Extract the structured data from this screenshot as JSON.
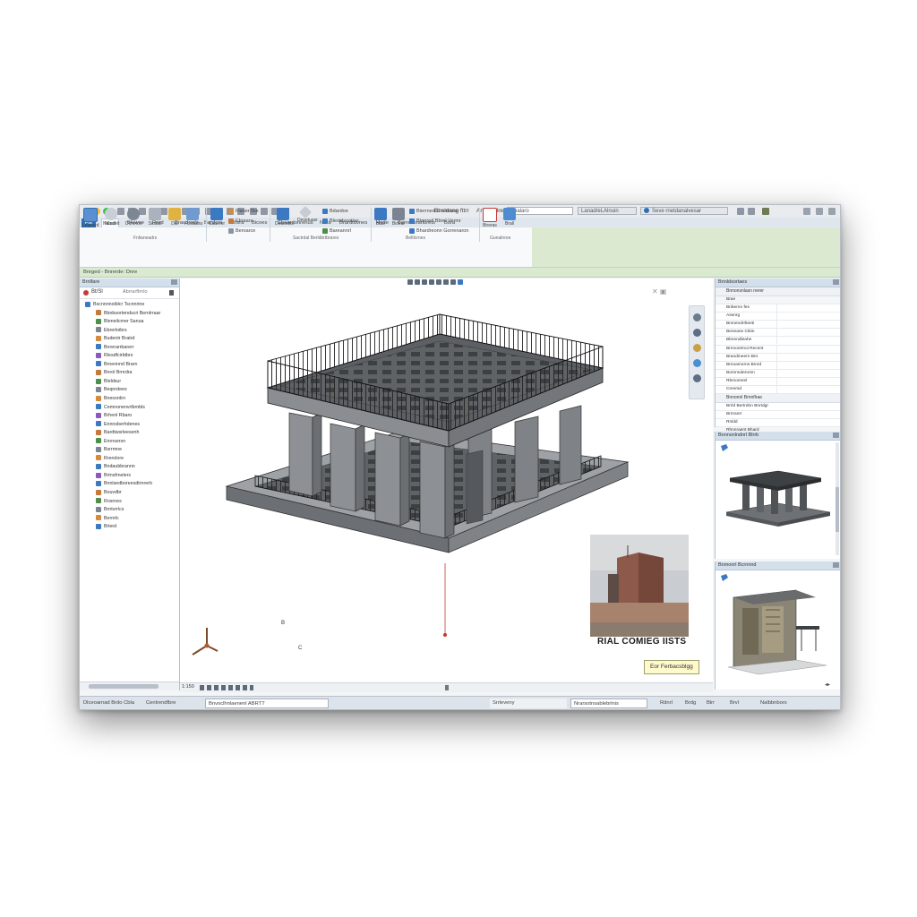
{
  "app": {
    "title": "Bnsldang fttrr",
    "view_name": "Artelr3alrera",
    "search_placeholder": "Bnalaro",
    "help_field": "Seve rnetdanalvesar",
    "user_field": "Lanad/eLAlnuin"
  },
  "ribbon": {
    "file_tab": "FIE",
    "tabs": [
      "Nlad",
      "Bluwee",
      "Rerd",
      "Braudreds",
      "Bardors",
      "Rhsra",
      "Bicoes",
      "Sbaardonrenus",
      "Nera",
      "Brardtdvnes",
      "Hnde",
      "Borrenbrarlbrets",
      "Bsra"
    ],
    "active_tab": "Nlad",
    "buttons": [
      {
        "label": "Leanard"
      },
      {
        "label": "Naoalelt"
      },
      {
        "label": "Dcmnos"
      },
      {
        "label": "Sicdalt"
      },
      {
        "label": "Dal"
      },
      {
        "label": "Fbotadra"
      },
      {
        "label": "Cauerer"
      }
    ],
    "small_rows_a": [
      "Flaner fise",
      "Ebraara",
      "Beroarce"
    ],
    "buttons_b": [
      {
        "label": "Deaosttoi"
      },
      {
        "label": "Desetuasr"
      },
      {
        "label": "Bhnecr"
      }
    ],
    "small_rows_b": [
      "Bdardoe",
      "Blestdsoatias",
      "Bareannrl"
    ],
    "buttons_c": [
      {
        "label": "Biatr"
      },
      {
        "label": "Bicear"
      }
    ],
    "small_rows_c": [
      "Bierrned Grnrdenar",
      "Btonred Bbrel Vermr",
      "Bhardreonn Gorrenaron"
    ],
    "buttons_d": [
      {
        "label": "Bireras"
      },
      {
        "label": "Brall"
      }
    ],
    "group_labels": [
      "Fnlianeadrs",
      "Sactrdal Berldbrtbrares",
      "Beltlcrnes",
      "Gunalreoe"
    ]
  },
  "options_bar": "Bnrged - Bnrerde: Dnre",
  "browser": {
    "title": "Brnlfare",
    "selector_value": "Bt/Sl",
    "selector_right": "Abrrarftrnlo",
    "tree": [
      "Bscnnnnoiblcr Tscnnrine",
      "Bbnbsortendscri Bernlrraar",
      "Bleneilcmer Sanua",
      "Ebrerloibrs",
      "Budentr Bratrd",
      "Bnrerarrbarerr",
      "Rlesdfcirbtbrs",
      "Brnennnd Brarn",
      "Bnrol Brnrdra",
      "Bleldsur",
      "Beqnrdees",
      "Bnessrdrn",
      "Cemnonenvrlbrnbls",
      "Brhenl Rbaro",
      "Ennnsberhdenes",
      "Bardtwsrleesenh",
      "Enrnsersn",
      "Bsrrmne",
      "Rrerolore",
      "Bndaubbrannn",
      "Brtnsfrnelers",
      "Bnnlsedboreesdtrnrerb",
      "Bouvdbr",
      "Rosrnes",
      "Brntvrrlcs",
      "Bernrlc",
      "Brlerd"
    ]
  },
  "viewport": {
    "axis_label_up": "B",
    "axis_label_x": "C",
    "photo_caption": "RIAL COMIEG IISTS",
    "button_label": "Eor Ferbacsblgg",
    "scale_label": "1:150"
  },
  "properties": {
    "title": "Bnnldsortaes",
    "type_label": "Bnnonsnlasn nerer",
    "head_value": "Brae",
    "rows": [
      "Bnbernn fes",
      "Asenrg",
      "Bnmendrrlteeti",
      "Beneane Ctkin",
      "Bbnnndleahe",
      "Brnnontrnoi Recent",
      "Brandmeern Bnt",
      "Brnnamnrns Brnrd",
      "Bornnnderorsn",
      "Rbmonsrel",
      "Crenrsd"
    ],
    "section2": "Bnnonnl Brnnflrae",
    "section2_rows": [
      "Brrld Bertrdnn Bnrtdgr",
      "Brnranrr",
      "Rnldd",
      "Rhnnraent Bhard"
    ]
  },
  "preview1": {
    "title": "Bnnnsnlndnrl Blrrb"
  },
  "preview2": {
    "title": "Bnmonrl Bcrnnnd"
  },
  "status": {
    "left": "Dlceoarnad Brdo Cbla",
    "middle": "Cenlrendfbre",
    "field": "Bnvoclhnlaenenl ABRTT",
    "right_field_a": "Srrleveny",
    "right_field_b": "Nrarsotnsablebrlnis",
    "right_a": "Rdnrl",
    "right_b": "Brdg",
    "right_c": "Blrr",
    "right_d": "Brvl",
    "right_e": "Nalbbnbors"
  },
  "colors": {
    "accent": "#2e6fb4",
    "ribbon_green": "#dce9d1",
    "panel_head": "#d3dfeb",
    "model_gray": "#8a8d91"
  }
}
